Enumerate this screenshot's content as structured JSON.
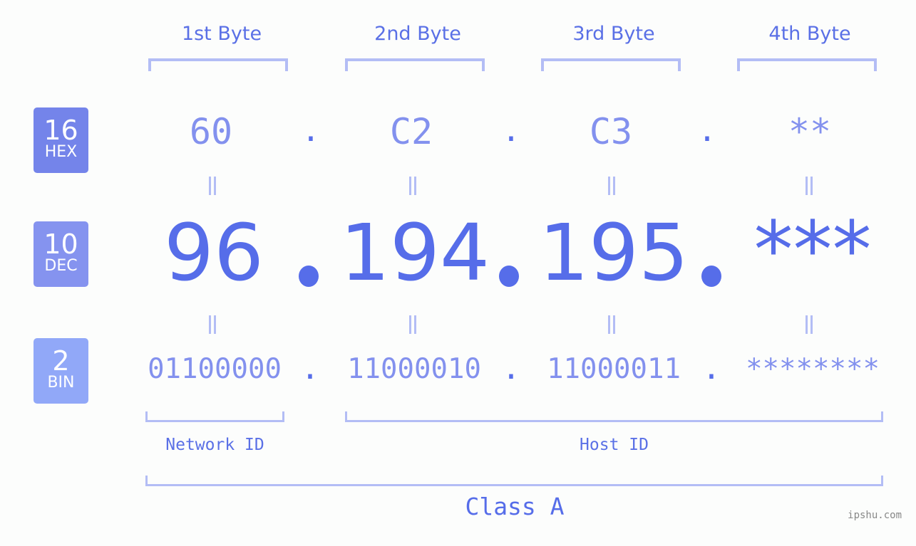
{
  "bytes": [
    {
      "label": "1st Byte",
      "hex": "60",
      "dec": "96",
      "bin": "01100000"
    },
    {
      "label": "2nd Byte",
      "hex": "C2",
      "dec": "194",
      "bin": "11000010"
    },
    {
      "label": "3rd Byte",
      "hex": "C3",
      "dec": "195",
      "bin": "11000011"
    },
    {
      "label": "4th Byte",
      "hex": "**",
      "dec": "***",
      "bin": "********"
    }
  ],
  "badges": {
    "hex": {
      "num": "16",
      "label": "HEX",
      "color": "#7484ea"
    },
    "dec": {
      "num": "10",
      "label": "DEC",
      "color": "#8593ef"
    },
    "bin": {
      "num": "2",
      "label": "BIN",
      "color": "#91a8f8"
    }
  },
  "separator": ".",
  "network_id_label": "Network ID",
  "host_id_label": "Host ID",
  "class_label": "Class A",
  "watermark": "ipshu.com"
}
